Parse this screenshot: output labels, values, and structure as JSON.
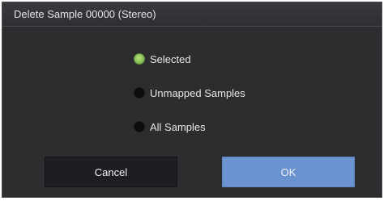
{
  "dialog": {
    "title": "Delete Sample 00000 (Stereo)"
  },
  "options": [
    {
      "label": "Selected",
      "selected": true
    },
    {
      "label": "Unmapped Samples",
      "selected": false
    },
    {
      "label": "All Samples",
      "selected": false
    }
  ],
  "buttons": {
    "cancel_label": "Cancel",
    "ok_label": "OK"
  },
  "colors": {
    "dialog_background": "#2d2d2f",
    "radio_selected": "#8cc25a",
    "ok_button": "#6b93cf",
    "cancel_button": "#1d1e23"
  }
}
